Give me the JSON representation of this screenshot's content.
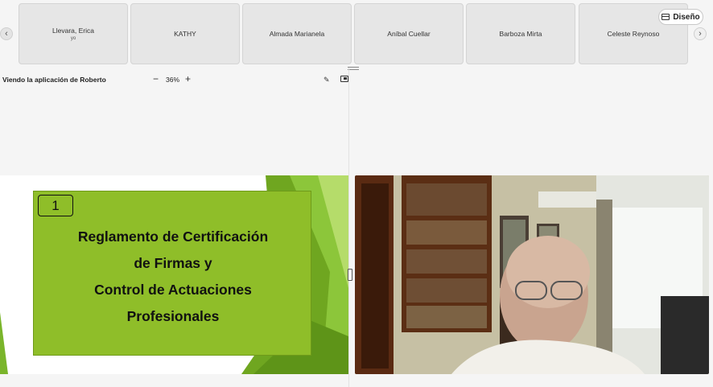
{
  "participants": [
    {
      "name": "Llevara, Erica",
      "sub": "yo"
    },
    {
      "name": "KATHY",
      "sub": ""
    },
    {
      "name": "Almada Marianela",
      "sub": ""
    },
    {
      "name": "Aníbal Cuellar",
      "sub": ""
    },
    {
      "name": "Barboza Mirta",
      "sub": ""
    },
    {
      "name": "Celeste Reynoso",
      "sub": ""
    }
  ],
  "nav": {
    "prev_glyph": "‹",
    "next_glyph": "›"
  },
  "layout_button": {
    "label": "Diseño"
  },
  "share_bar": {
    "label": "Viendo la aplicación de Roberto",
    "zoom_out": "−",
    "zoom": "36%",
    "zoom_in": "+"
  },
  "slide": {
    "number": "1",
    "title_lines": [
      "Reglamento de Certificación",
      "de Firmas y",
      "Control de Actuaciones",
      "Profesionales"
    ]
  },
  "icons": {
    "prev": "chevron-left-icon",
    "next": "chevron-right-icon",
    "layout": "layout-icon",
    "annotate": "annotate-icon",
    "popout": "pop-out-icon"
  },
  "colors": {
    "slide_green": "#8fbe29",
    "background": "#f5f5f5"
  }
}
